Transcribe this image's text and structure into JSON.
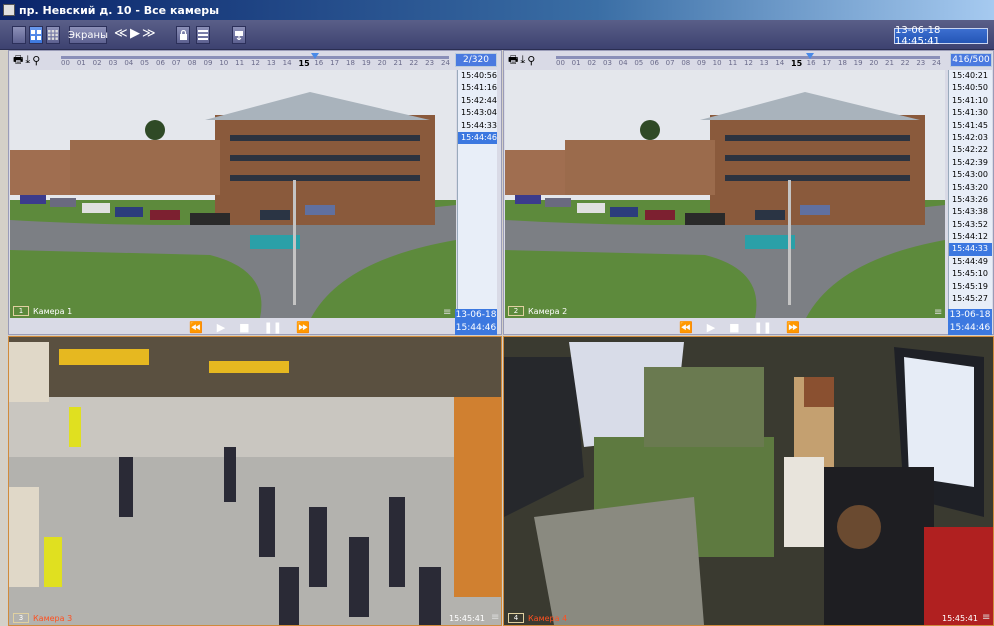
{
  "window": {
    "title": "пр. Невский д. 10 - Все камеры"
  },
  "toolbar": {
    "screens_label": "Экраны",
    "datetime": "13-06-18 14:45:41",
    "icons": [
      "layout-single-icon",
      "layout-quad-icon",
      "layout-grid-icon",
      "rewind-icon",
      "play-icon",
      "fast-forward-icon",
      "lock-icon",
      "list-icon",
      "export-icon"
    ]
  },
  "timeline": {
    "hours": [
      "00",
      "01",
      "02",
      "03",
      "04",
      "05",
      "06",
      "07",
      "08",
      "09",
      "10",
      "11",
      "12",
      "13",
      "14",
      "15",
      "16",
      "17",
      "18",
      "19",
      "20",
      "21",
      "22",
      "23",
      "24"
    ],
    "current_hour": "15"
  },
  "cameras": {
    "cam1": {
      "number": "1",
      "name": "Камера 1",
      "frame_counter": "2/320",
      "timestamps": [
        "15:40:56",
        "15:41:16",
        "15:42:44",
        "15:43:04",
        "15:44:33",
        "15:44:46"
      ],
      "selected_index": 5,
      "date": "13-06-18",
      "time": "15:44:46"
    },
    "cam2": {
      "number": "2",
      "name": "Камера 2",
      "frame_counter": "416/500",
      "timestamps": [
        "15:40:21",
        "15:40:50",
        "15:41:10",
        "15:41:30",
        "15:41:45",
        "15:42:03",
        "15:42:22",
        "15:42:39",
        "15:43:00",
        "15:43:20",
        "15:43:26",
        "15:43:38",
        "15:43:52",
        "15:44:12",
        "15:44:33",
        "15:44:49",
        "15:45:10",
        "15:45:19",
        "15:45:27"
      ],
      "selected_index": 14,
      "date": "13-06-18",
      "time": "15:44:46"
    },
    "cam3": {
      "number": "3",
      "name": "Камера 3",
      "time": "15:45:41"
    },
    "cam4": {
      "number": "4",
      "name": "Камера 4",
      "time": "15:45:41"
    }
  },
  "colors": {
    "accent": "#3c78e0",
    "title_bar": "#0a246a",
    "panel": "#3d4270",
    "active_border": "#d08a3c"
  }
}
